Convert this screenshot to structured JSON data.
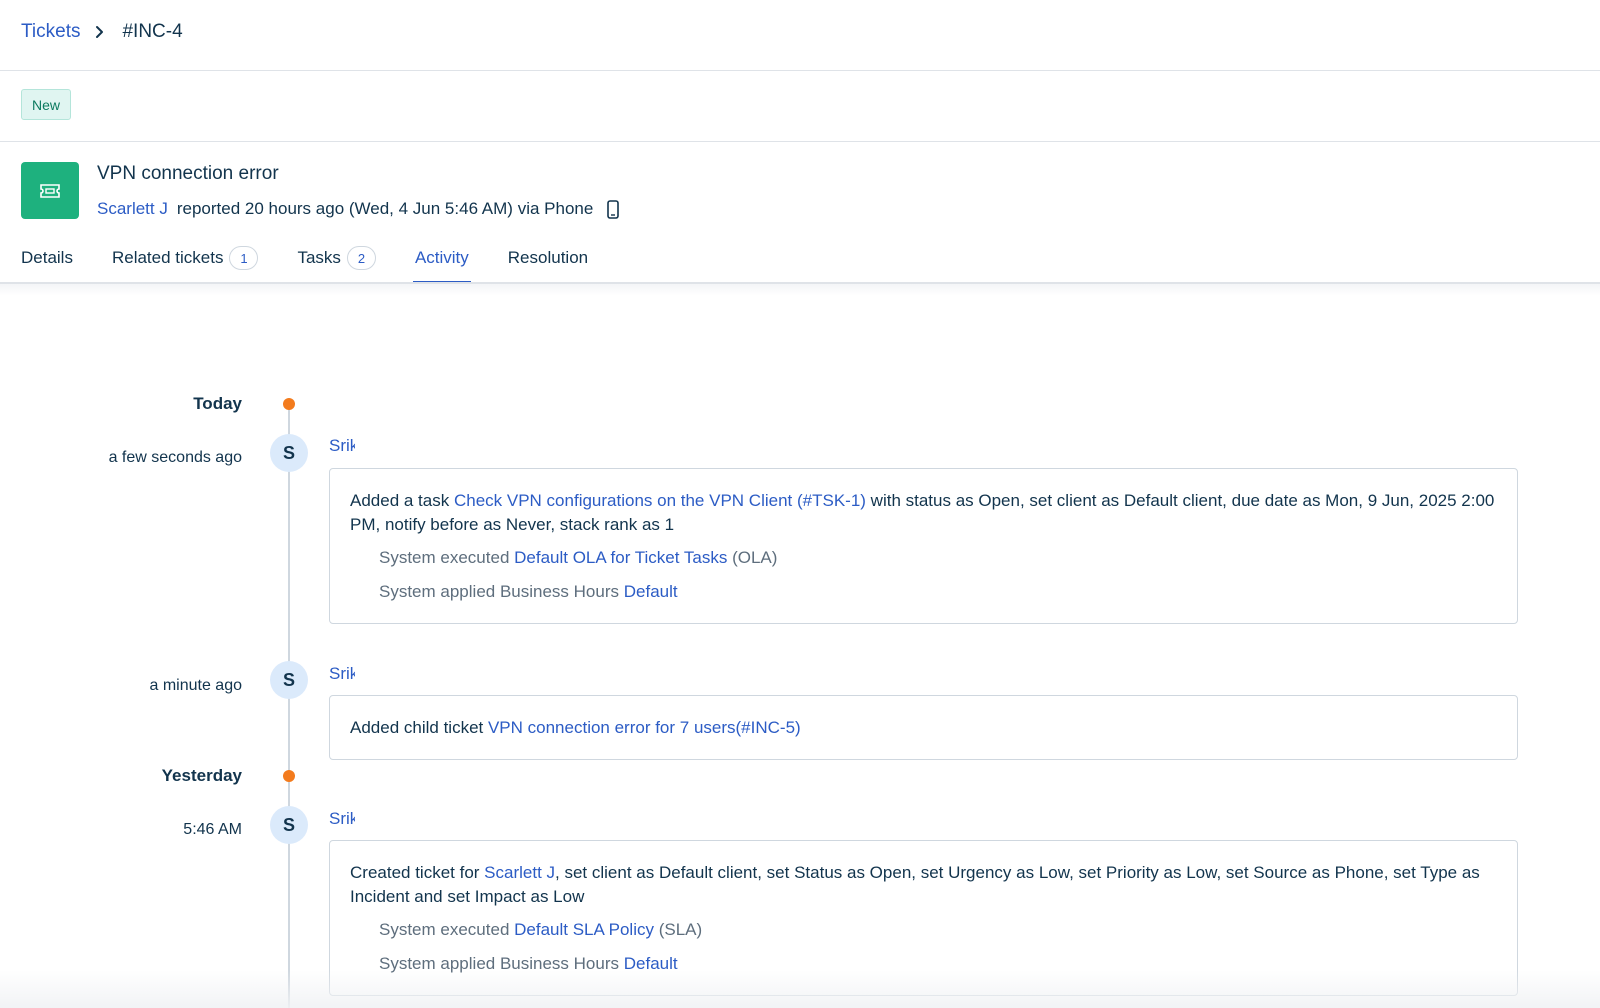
{
  "breadcrumb": {
    "parent": "Tickets",
    "current": "#INC-4"
  },
  "ticket": {
    "status": "New",
    "title": "VPN connection error",
    "reporter": "Scarlett J",
    "reported_text": "reported 20 hours ago (Wed, 4 Jun 5:46 AM) via Phone",
    "icon": "ticket-icon",
    "source_icon": "phone-icon"
  },
  "tabs": [
    {
      "label": "Details"
    },
    {
      "label": "Related tickets",
      "count": "1"
    },
    {
      "label": "Tasks",
      "count": "2"
    },
    {
      "label": "Activity",
      "active": true
    },
    {
      "label": "Resolution"
    }
  ],
  "activity": {
    "groups": [
      {
        "day": "Today",
        "events": [
          {
            "time": "a few seconds ago",
            "avatar": "S",
            "actor": "Srikanth",
            "text_prefix": "Added a task ",
            "link": "Check VPN configurations on the VPN Client (#TSK-1)",
            "text_suffix": " with status as Open, set client as Default client, due date as Mon, 9 Jun, 2025 2:00 PM, notify before as Never, stack rank as 1",
            "system": [
              {
                "prefix": "System executed ",
                "link": "Default OLA for Ticket Tasks",
                "suffix": " (OLA)"
              },
              {
                "prefix": "System applied Business Hours ",
                "link": "Default",
                "suffix": ""
              }
            ]
          },
          {
            "time": "a minute ago",
            "avatar": "S",
            "actor": "Srikanth",
            "text_prefix": "Added child ticket ",
            "link": "VPN connection error for 7 users(#INC-5)"
          }
        ]
      },
      {
        "day": "Yesterday",
        "events": [
          {
            "time": "5:46 AM",
            "avatar": "S",
            "actor": "Srikanth",
            "text_prefix": "Created ticket for ",
            "link": "Scarlett J",
            "text_suffix": ", set client as Default client, set Status as Open, set Urgency as Low, set Priority as Low, set Source as Phone, set Type as Incident and set Impact as Low",
            "system": [
              {
                "prefix": "System executed ",
                "link": "Default SLA Policy",
                "suffix": " (SLA)"
              },
              {
                "prefix": "System applied Business Hours ",
                "link": "Default",
                "suffix": ""
              }
            ]
          }
        ]
      }
    ]
  },
  "colors": {
    "accent": "#2c5cc5",
    "ticket_icon_bg": "#1eb17e",
    "day_dot": "#f37b1d",
    "status_new_bg": "#e0f5f1"
  }
}
